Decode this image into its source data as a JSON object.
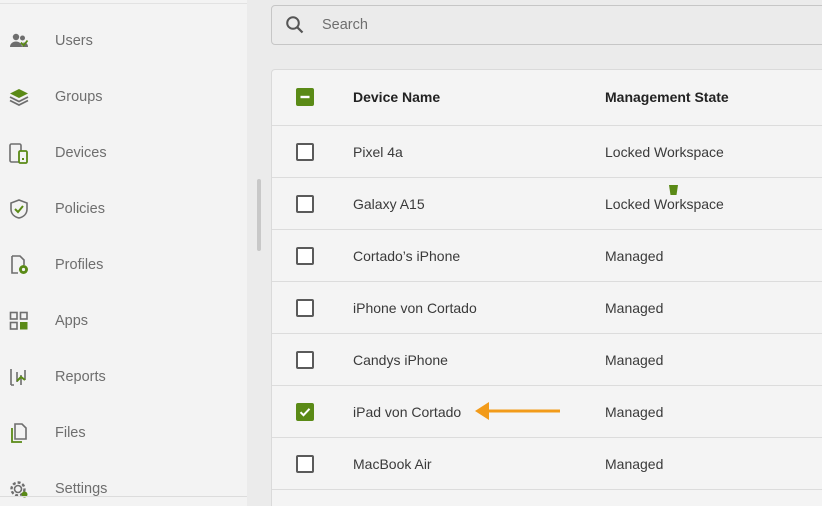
{
  "sidebar": {
    "items": [
      {
        "label": "Users",
        "icon": "users-icon"
      },
      {
        "label": "Groups",
        "icon": "layers-icon"
      },
      {
        "label": "Devices",
        "icon": "devices-icon"
      },
      {
        "label": "Policies",
        "icon": "shield-check-icon"
      },
      {
        "label": "Profiles",
        "icon": "profile-gear-icon"
      },
      {
        "label": "Apps",
        "icon": "apps-grid-icon"
      },
      {
        "label": "Reports",
        "icon": "reports-chart-icon"
      },
      {
        "label": "Files",
        "icon": "files-icon"
      },
      {
        "label": "Settings",
        "icon": "settings-gear-icon"
      }
    ]
  },
  "search": {
    "placeholder": "Search",
    "value": ""
  },
  "table": {
    "columns": {
      "name": "Device Name",
      "state": "Management State"
    },
    "rows": [
      {
        "name": "Pixel 4a",
        "state": "Locked Workspace",
        "checked": false
      },
      {
        "name": "Galaxy A15",
        "state": "Locked Workspace",
        "checked": false
      },
      {
        "name": "Cortado’s iPhone",
        "state": "Managed",
        "checked": false
      },
      {
        "name": "iPhone von Cortado",
        "state": "Managed",
        "checked": false
      },
      {
        "name": "Candys iPhone",
        "state": "Managed",
        "checked": false
      },
      {
        "name": "iPad von Cortado",
        "state": "Managed",
        "checked": true
      },
      {
        "name": "MacBook Air",
        "state": "Managed",
        "checked": false
      }
    ]
  },
  "colors": {
    "accent": "#5a8a16",
    "annotation_arrow": "#f29b1a",
    "icon_gray": "#6e6e6e"
  }
}
